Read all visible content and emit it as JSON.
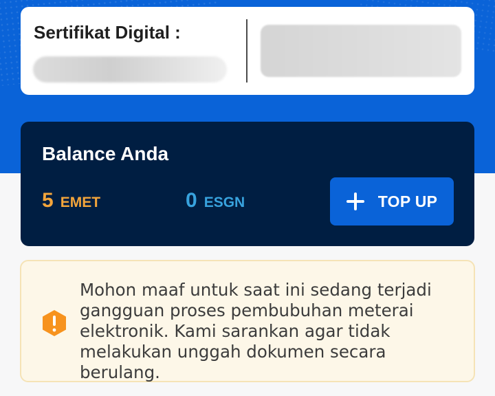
{
  "certificate": {
    "title": "Sertifikat Digital :"
  },
  "balance": {
    "title": "Balance Anda",
    "emet": {
      "value": "5",
      "unit": "EMET"
    },
    "esgn": {
      "value": "0",
      "unit": "ESGN"
    },
    "topup_label": "TOP UP"
  },
  "notice": {
    "icon": "warning-hexagon-icon",
    "lines": [
      "Mohon maaf untuk saat ini sedang terjadi",
      "gangguan proses pembubuhan meterai",
      "elektronik. Kami sarankan agar tidak",
      "melakukan unggah dokumen secara berulang."
    ]
  },
  "colors": {
    "brand_blue": "#0a63d8",
    "navy": "#001e42",
    "emet_orange": "#f3a53b",
    "esgn_cyan": "#38a3de",
    "warning_orange": "#f7931e"
  }
}
